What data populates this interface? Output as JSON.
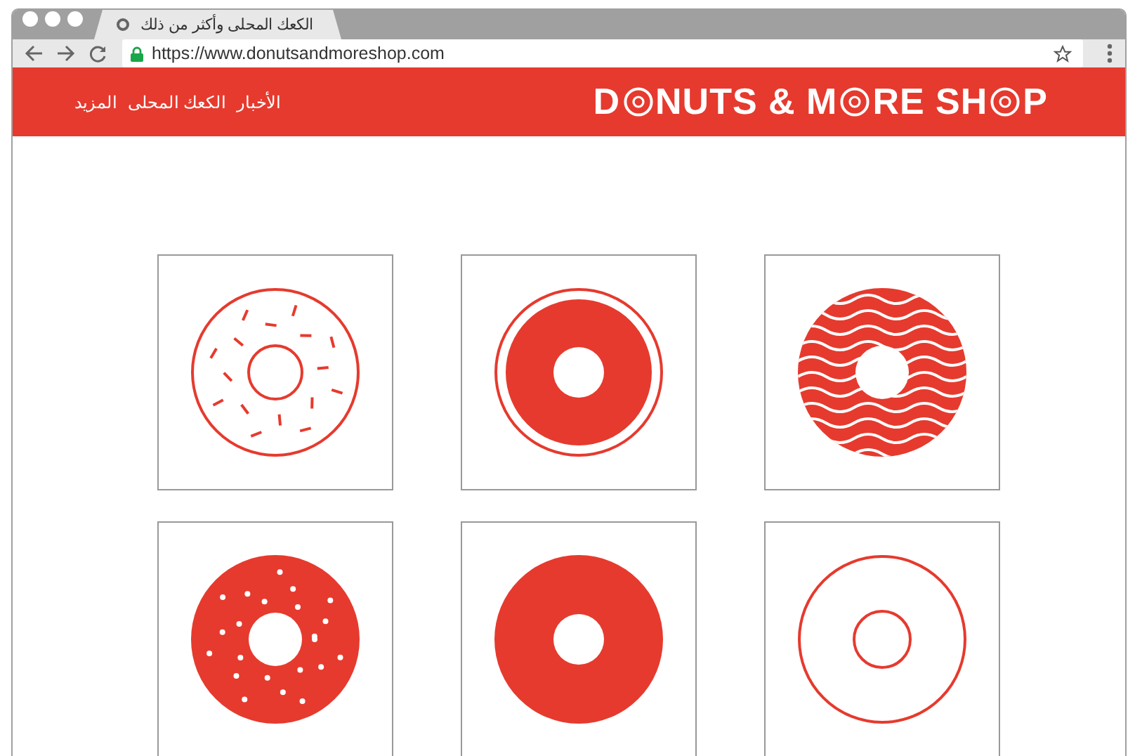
{
  "browser": {
    "tab_title": "الكعك المحلى وأكثر من ذلك",
    "url": "https://www.donutsandmoreshop.com"
  },
  "header": {
    "nav": [
      "الأخبار",
      "الكعك المحلى",
      "المزيد"
    ],
    "logo": {
      "segment_1": "D",
      "segment_2": "NUTS & M",
      "segment_3": "RE SH",
      "segment_4": "P"
    }
  },
  "donuts": [
    {
      "kind": "sprinkles"
    },
    {
      "kind": "ring"
    },
    {
      "kind": "waves"
    },
    {
      "kind": "dots"
    },
    {
      "kind": "solid"
    },
    {
      "kind": "outline"
    }
  ]
}
